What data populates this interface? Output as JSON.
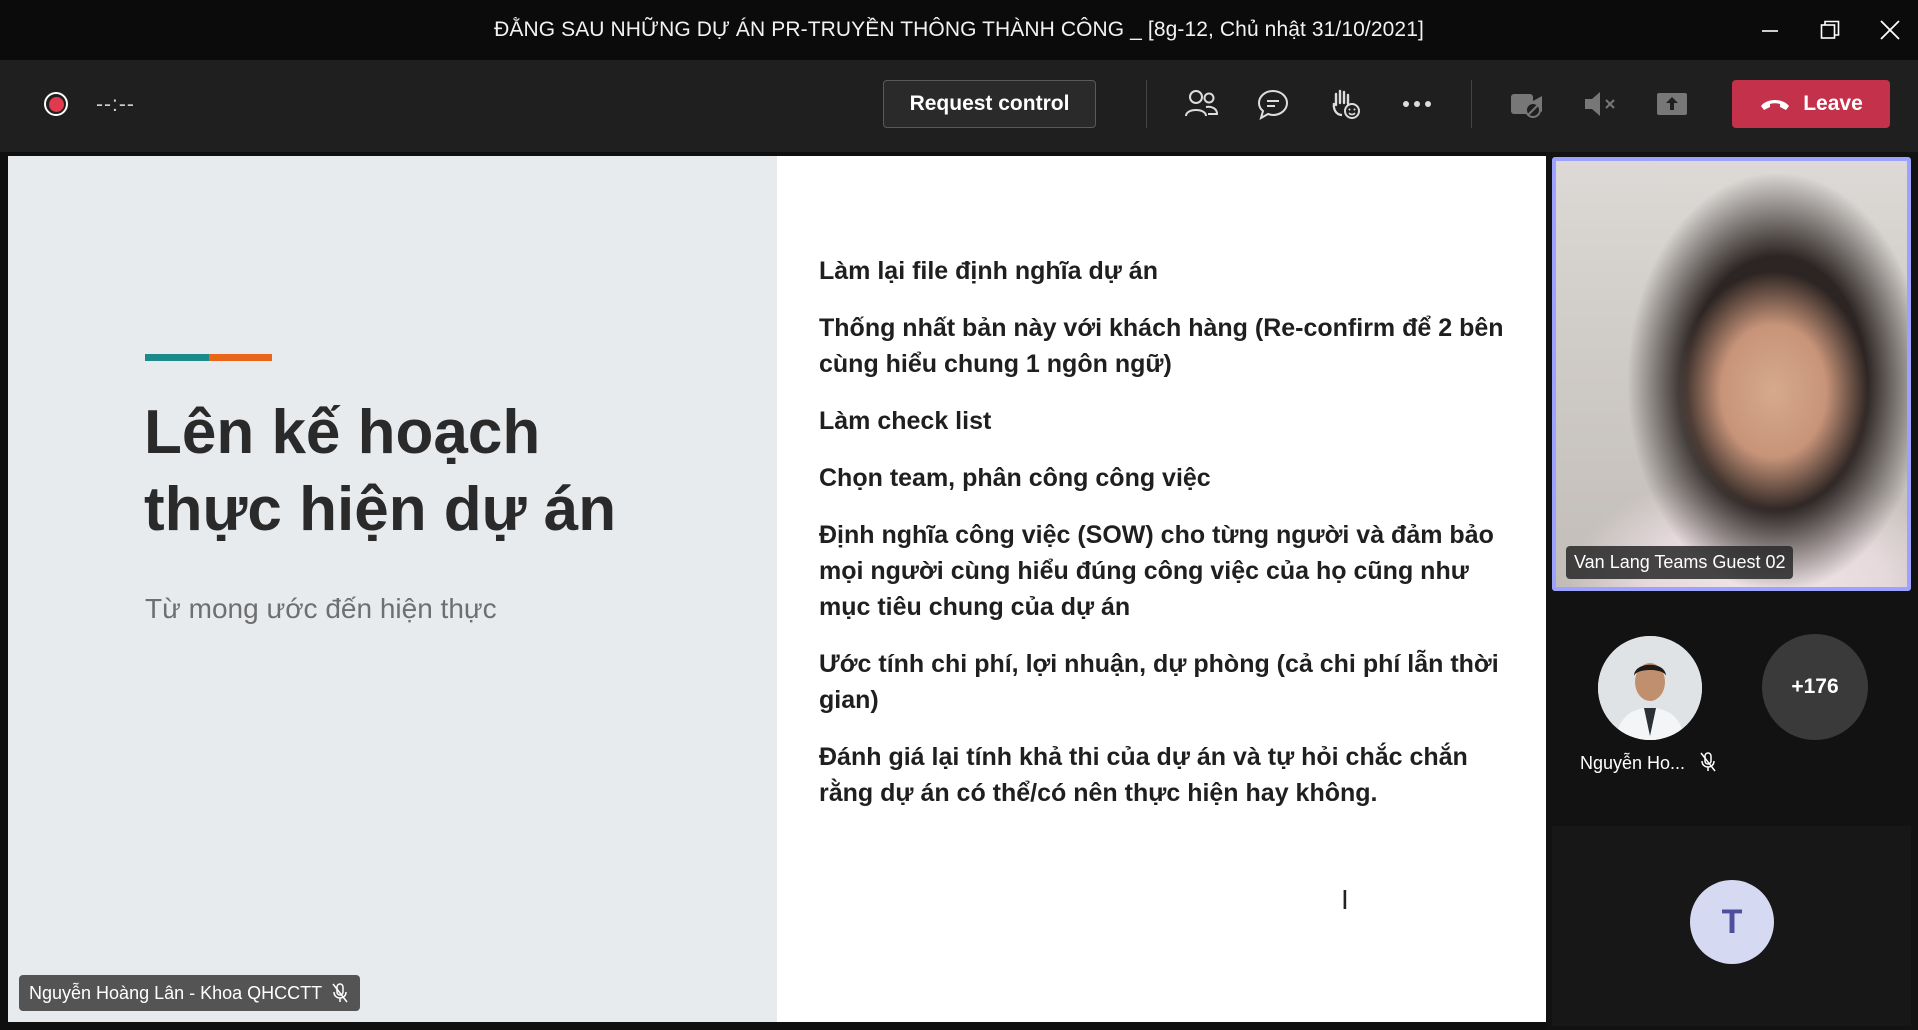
{
  "window": {
    "title": "ĐẰNG SAU NHỮNG DỰ ÁN PR-TRUYỀN THÔNG THÀNH CÔNG _ [8g-12, Chủ nhật 31/10/2021]"
  },
  "toolbar": {
    "timer": "--:--",
    "request_control_label": "Request control",
    "leave_label": "Leave",
    "icons": [
      "people-icon",
      "chat-icon",
      "raise-hand-icon",
      "more-icon",
      "camera-off-icon",
      "speaker-mute-icon",
      "share-tray-icon"
    ]
  },
  "slide": {
    "title_line1": "Lên kế hoạch",
    "title_line2": "thực hiện dự án",
    "subtitle": "Từ mong ước đến hiện thực",
    "accent_colors": [
      "#1b8a8a",
      "#e8651a"
    ],
    "bullets": [
      "Làm lại file định nghĩa dự án",
      "Thống nhất bản này với khách hàng (Re-confirm để 2 bên cùng hiểu chung 1 ngôn ngữ)",
      "Làm check list",
      "Chọn team, phân công công việc",
      "Định nghĩa công việc (SOW) cho từng người và đảm bảo mọi người cùng hiểu đúng công việc của họ cũng như mục tiêu chung của dự án",
      "Ước tính chi phí, lợi nhuận, dự phòng (cả chi phí lẫn thời gian)",
      "Đánh giá lại tính khả thi của dự án và tự hỏi chắc chắn rằng dự án có thể/có nên thực hiện hay không."
    ]
  },
  "presenter": {
    "name": "Nguyễn Hoàng Lân - Khoa QHCCTT"
  },
  "participants": {
    "video_tile_name": "Van Lang Teams Guest 02",
    "tile_name": "Nguyễn Ho...",
    "overflow_count": "+176",
    "initial_avatar": "T"
  },
  "colors": {
    "leave": "#c4314b",
    "active_speaker_border": "#9ea2ff",
    "record": "#e03a4e"
  }
}
